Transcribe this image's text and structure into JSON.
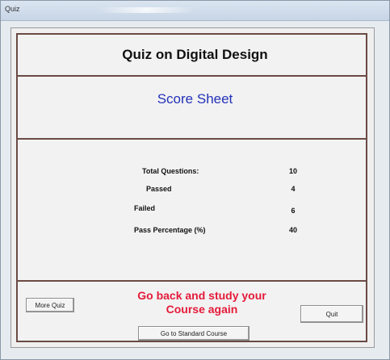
{
  "window": {
    "title": "Quiz"
  },
  "header": {
    "quiz_title": "Quiz on Digital Design",
    "score_title": "Score Sheet"
  },
  "stats": [
    {
      "label": "Total Questions:",
      "value": "10"
    },
    {
      "label": "Passed",
      "value": "4"
    },
    {
      "label": "Failed",
      "value": "6"
    },
    {
      "label": "Pass Percentage (%)",
      "value": "40"
    }
  ],
  "footer": {
    "more_quiz_label": "More Quiz",
    "message": "Go back and study your Course again",
    "quit_label": "Quit",
    "standard_course_label": "Go to Standard Course"
  }
}
